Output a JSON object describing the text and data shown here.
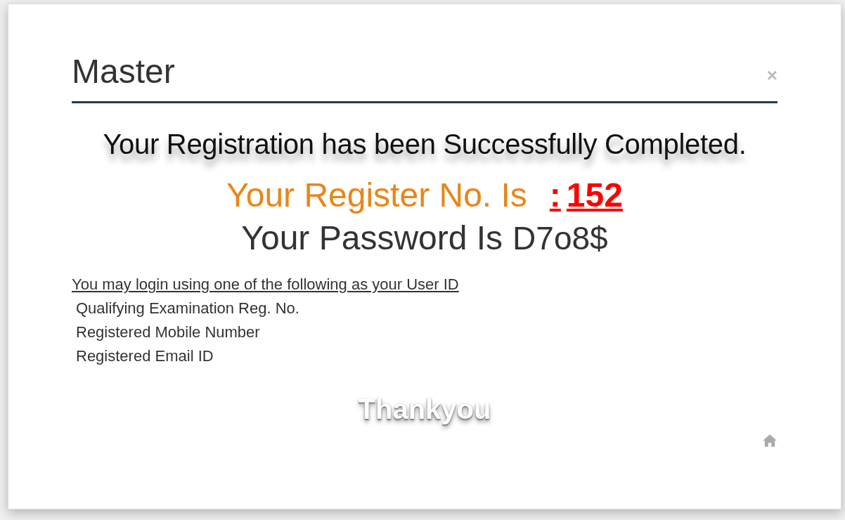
{
  "dialog": {
    "title": "Master",
    "close": "×"
  },
  "message": "Your Registration has been Successfully Completed.",
  "register": {
    "label": "Your Register No. Is",
    "separator": ":",
    "number": "152"
  },
  "password": {
    "label": "Your Password Is",
    "value": "D7o8$"
  },
  "login_hint": "You may login using one of the following as your User ID",
  "user_id_options": [
    "Qualifying Examination Reg. No.",
    "Registered Mobile Number",
    "Registered Email ID"
  ],
  "footer": "Thankyou"
}
